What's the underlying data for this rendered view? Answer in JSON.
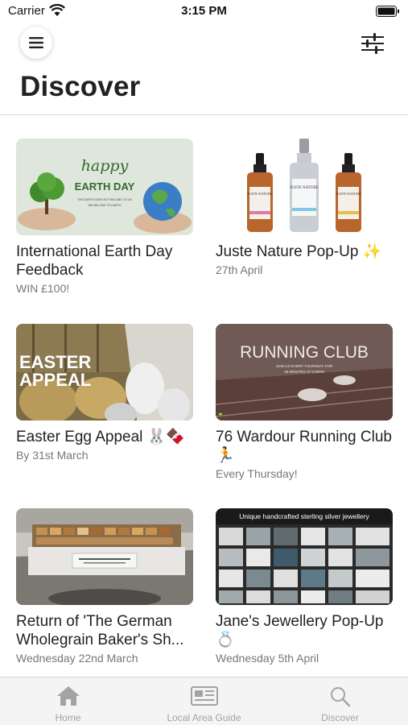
{
  "status_bar": {
    "carrier": "Carrier",
    "time": "3:15 PM"
  },
  "header": {
    "title": "Discover"
  },
  "cards": [
    {
      "title": "International Earth Day Feedback",
      "subtitle": "WIN £100!",
      "image_text": {
        "line1": "happy",
        "line2": "EARTH DAY",
        "line3": "THE EARTH DOES NOT BELONG TO US",
        "line4": "WE BELONG TO EARTH"
      }
    },
    {
      "title": "Juste Nature Pop-Up ✨",
      "subtitle": "27th April",
      "image_text": {
        "brand": "JUSTE NATURE"
      }
    },
    {
      "title": "Easter Egg Appeal 🐰🍫",
      "subtitle": "By 31st March",
      "image_text": {
        "line1": "EASTER",
        "line2": "APPEAL"
      }
    },
    {
      "title": "76 Wardour Running Club 🏃",
      "subtitle": "Every Thursday!",
      "image_text": {
        "line1": "RUNNING CLUB",
        "line2": "JOIN US EVERY THURSDAY FOR",
        "line3": "45 MINUTES AT 6:30PM"
      }
    },
    {
      "title": "Return of 'The German Wholegrain Baker's Sh...",
      "subtitle": "Wednesday 22nd March"
    },
    {
      "title": "Jane's Jewellery Pop-Up 💍",
      "subtitle": "Wednesday 5th April",
      "image_text": {
        "line1": "Unique handcrafted sterling silver jewellery"
      }
    }
  ],
  "tabs": [
    {
      "label": "Home",
      "icon": "home-icon"
    },
    {
      "label": "Local Area Guide",
      "icon": "newspaper-icon"
    },
    {
      "label": "Discover",
      "icon": "search-icon"
    }
  ],
  "colors": {
    "text": "#222222",
    "muted": "#777777",
    "tab_inactive": "#a3a3a3",
    "tab_bar_bg": "#f4f4f4"
  }
}
